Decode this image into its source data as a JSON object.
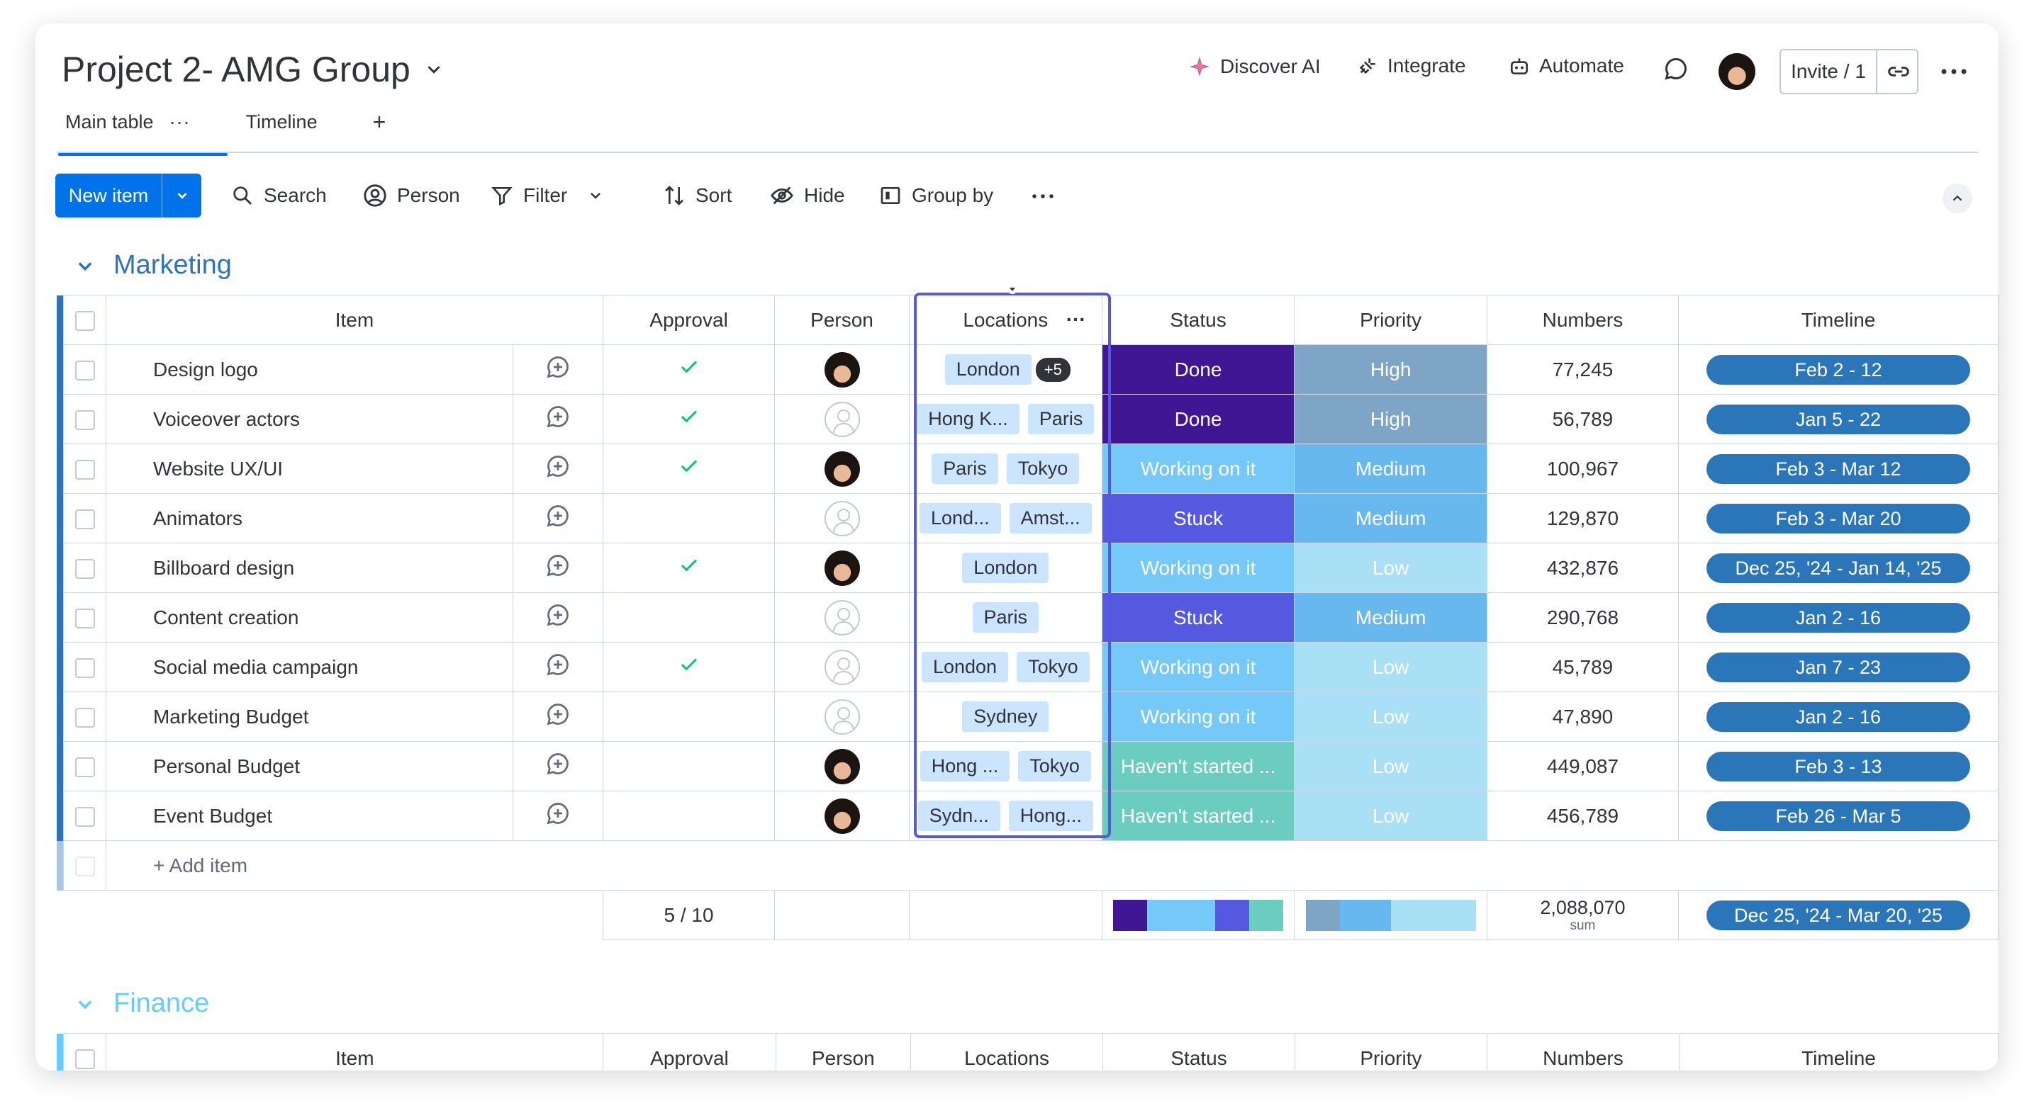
{
  "header": {
    "title": "Project 2- AMG Group",
    "discover_ai": "Discover AI",
    "integrate": "Integrate",
    "automate": "Automate",
    "invite": "Invite / 1"
  },
  "tabs": {
    "main": "Main table",
    "timeline": "Timeline",
    "add": "+"
  },
  "toolbar": {
    "new_item": "New item",
    "search": "Search",
    "person": "Person",
    "filter": "Filter",
    "sort": "Sort",
    "hide": "Hide",
    "group_by": "Group by"
  },
  "columns": {
    "item": "Item",
    "approval": "Approval",
    "person": "Person",
    "locations": "Locations",
    "status": "Status",
    "priority": "Priority",
    "numbers": "Numbers",
    "timeline": "Timeline"
  },
  "colors": {
    "done": "#401694",
    "stuck": "#5559df",
    "working": "#75c9f9",
    "not_started": "#6bccc0",
    "high": "#7ea5c5",
    "medium": "#66b8ee",
    "low": "#a9e0f5",
    "timeline": "#2b76b9",
    "accent": "#0073ea"
  },
  "groups": [
    {
      "name": "Marketing",
      "color": "#2e73b8",
      "add_item": "+ Add item",
      "rows": [
        {
          "item": "Design logo",
          "approved": true,
          "person": "avatar",
          "locations": [
            "London"
          ],
          "more": "+5",
          "status": "Done",
          "priority": "High",
          "number": "77,245",
          "timeline": "Feb 2 - 12"
        },
        {
          "item": "Voiceover actors",
          "approved": true,
          "person": "empty",
          "locations": [
            "Hong K...",
            "Paris"
          ],
          "status": "Done",
          "priority": "High",
          "number": "56,789",
          "timeline": "Jan 5 - 22"
        },
        {
          "item": "Website UX/UI",
          "approved": true,
          "person": "avatar",
          "locations": [
            "Paris",
            "Tokyo"
          ],
          "status": "Working on it",
          "priority": "Medium",
          "number": "100,967",
          "timeline": "Feb 3 - Mar 12"
        },
        {
          "item": "Animators",
          "approved": false,
          "person": "empty",
          "locations": [
            "Lond...",
            "Amst..."
          ],
          "status": "Stuck",
          "priority": "Medium",
          "number": "129,870",
          "timeline": "Feb 3 - Mar 20"
        },
        {
          "item": "Billboard design",
          "approved": true,
          "person": "avatar",
          "locations": [
            "London"
          ],
          "status": "Working on it",
          "priority": "Low",
          "number": "432,876",
          "timeline": "Dec 25, '24 - Jan 14, '25"
        },
        {
          "item": "Content creation",
          "approved": false,
          "person": "empty",
          "locations": [
            "Paris"
          ],
          "status": "Stuck",
          "priority": "Medium",
          "number": "290,768",
          "timeline": "Jan 2 - 16"
        },
        {
          "item": "Social media campaign",
          "approved": true,
          "person": "empty",
          "locations": [
            "London",
            "Tokyo"
          ],
          "status": "Working on it",
          "priority": "Low",
          "number": "45,789",
          "timeline": "Jan 7 - 23"
        },
        {
          "item": "Marketing Budget",
          "approved": false,
          "person": "empty",
          "locations": [
            "Sydney"
          ],
          "status": "Working on it",
          "priority": "Low",
          "number": "47,890",
          "timeline": "Jan 2 - 16"
        },
        {
          "item": "Personal Budget",
          "approved": false,
          "person": "avatar",
          "locations": [
            "Hong ...",
            "Tokyo"
          ],
          "status": "Haven't started ...",
          "priority": "Low",
          "number": "449,087",
          "timeline": "Feb 3 - 13"
        },
        {
          "item": "Event Budget",
          "approved": false,
          "person": "avatar",
          "locations": [
            "Sydn...",
            "Hong..."
          ],
          "status": "Haven't started ...",
          "priority": "Low",
          "number": "456,789",
          "timeline": "Feb 26 - Mar 5"
        }
      ],
      "summary": {
        "approval": "5 / 10",
        "numbers": "2,088,070",
        "numbers_label": "sum",
        "timeline": "Dec 25, '24 - Mar 20, '25",
        "status_dist": [
          {
            "color": "#401694",
            "share": 0.2
          },
          {
            "color": "#75c9f9",
            "share": 0.4
          },
          {
            "color": "#5559df",
            "share": 0.2
          },
          {
            "color": "#6bccc0",
            "share": 0.2
          }
        ],
        "priority_dist": [
          {
            "color": "#7ea5c5",
            "share": 0.2
          },
          {
            "color": "#66b8ee",
            "share": 0.3
          },
          {
            "color": "#a9e0f5",
            "share": 0.5
          }
        ]
      }
    },
    {
      "name": "Finance",
      "color": "#66ccff"
    }
  ]
}
